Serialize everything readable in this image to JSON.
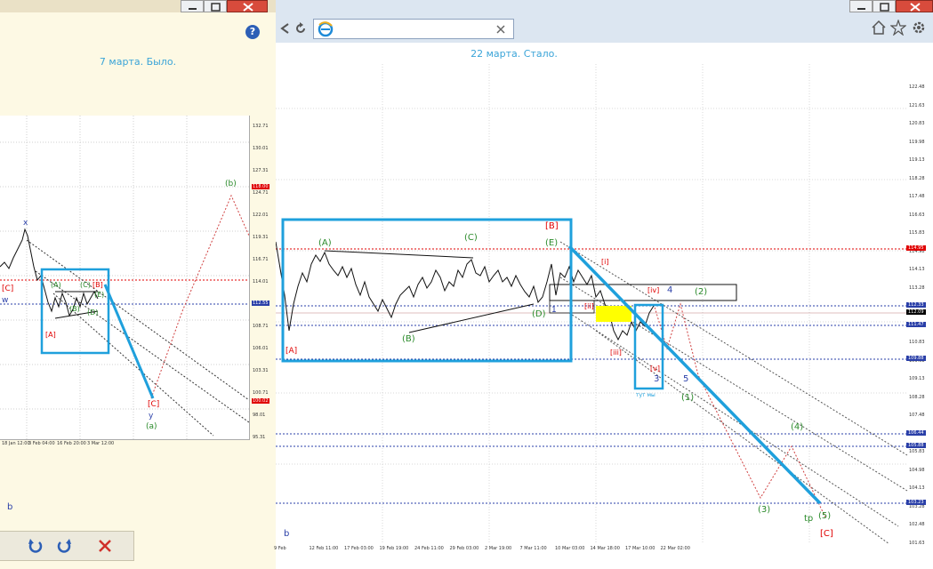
{
  "left_window": {
    "title": "7 марта. Было.",
    "help_glyph": "?",
    "corner_label": "b",
    "chart": {
      "wave_labels": {
        "x": "x",
        "w": "w",
        "b_top": "(b)",
        "C_left": "[C]",
        "A_bracket": "[A]",
        "A_paren": "(A)",
        "B_paren": "(B)",
        "C_paren": "(C)",
        "D_paren": "(D)",
        "E_paren": "(E)",
        "B_bracket": "[B]",
        "C_bottom": "[C]",
        "y": "y",
        "a_paren": "(a)"
      },
      "price_ticks": [
        "132.71",
        "130.01",
        "127.31",
        "124.71",
        "122.01",
        "119.31",
        "116.71",
        "114.01",
        "111.31",
        "108.71",
        "106.01",
        "103.31",
        "100.71",
        "98.01",
        "95.31"
      ],
      "date_ticks": [
        "18 Jan 12:00",
        "3 Feb 04:00",
        "16 Feb 20:00",
        "3 Mar 12:00"
      ],
      "price_highlight_1": "118.00",
      "price_highlight_2": "112.55",
      "price_highlight_3": "100.02"
    },
    "toolbar": {
      "back_icon": "rotate-left-icon",
      "forward_icon": "rotate-right-icon",
      "close_icon": "close-icon"
    }
  },
  "right_window": {
    "title": "22 марта. Стало.",
    "corner_label": "b",
    "chart": {
      "wave_labels": {
        "A_bracket": "[A]",
        "A_paren": "(A)",
        "B_paren": "(B)",
        "C_paren": "(C)",
        "D_paren": "(D)",
        "E_paren": "(E)",
        "B_bracket": "[B]",
        "i_roman": "[i]",
        "ii_roman": "[ii]",
        "iii_roman": "[iii]",
        "iv_roman": "[iv]",
        "v_roman": "[v]",
        "one_small": "1",
        "four": "4",
        "two_paren": "(2)",
        "three": "3",
        "five": "5",
        "one_paren": "(1)",
        "tut_note": "тут мы",
        "four_paren": "(4)",
        "three_paren": "(3)",
        "five_paren": "(5)",
        "tp": "tp",
        "C_bracket": "[C]"
      },
      "price_ticks": [
        "122.48",
        "121.63",
        "120.83",
        "119.98",
        "119.13",
        "118.28",
        "117.48",
        "116.63",
        "115.83",
        "114.98",
        "114.13",
        "113.28",
        "112.48",
        "111.63",
        "110.83",
        "109.98",
        "109.13",
        "108.28",
        "107.48",
        "106.63",
        "105.83",
        "104.98",
        "104.13",
        "103.28",
        "102.48",
        "101.63"
      ],
      "price_highlights": [
        {
          "value": "114.95",
          "color": "#e00000"
        },
        {
          "value": "112.33",
          "color": "#2a3fa8"
        },
        {
          "value": "112.09",
          "color": "#000000"
        },
        {
          "value": "111.47",
          "color": "#2a3fa8"
        },
        {
          "value": "109.88",
          "color": "#2a3fa8"
        },
        {
          "value": "106.44",
          "color": "#2a3fa8"
        },
        {
          "value": "105.88",
          "color": "#2a3fa8"
        },
        {
          "value": "103.23",
          "color": "#2a3fa8"
        }
      ],
      "date_ticks": [
        "9 Feb",
        "12 Feb 11:00",
        "17 Feb 03:00",
        "19 Feb 19:00",
        "24 Feb 11:00",
        "29 Feb 03:00",
        "2 Mar 19:00",
        "7 Mar 11:00",
        "10 Mar 03:00",
        "14 Mar 18:00",
        "17 Mar 10:00",
        "22 Mar 02:00"
      ]
    },
    "browser": {
      "back_icon": "back-arrow-icon",
      "refresh_icon": "refresh-icon",
      "ie_icon": "internet-explorer-icon",
      "home_icon": "home-icon",
      "favorites_icon": "star-icon",
      "settings_icon": "gear-icon"
    }
  },
  "colors": {
    "blue_box": "#1fa0dc",
    "green_label": "#2a8a2a",
    "red_label": "#e00000",
    "navy_label": "#2a3fa8",
    "title_blue": "#3aa4d8"
  }
}
